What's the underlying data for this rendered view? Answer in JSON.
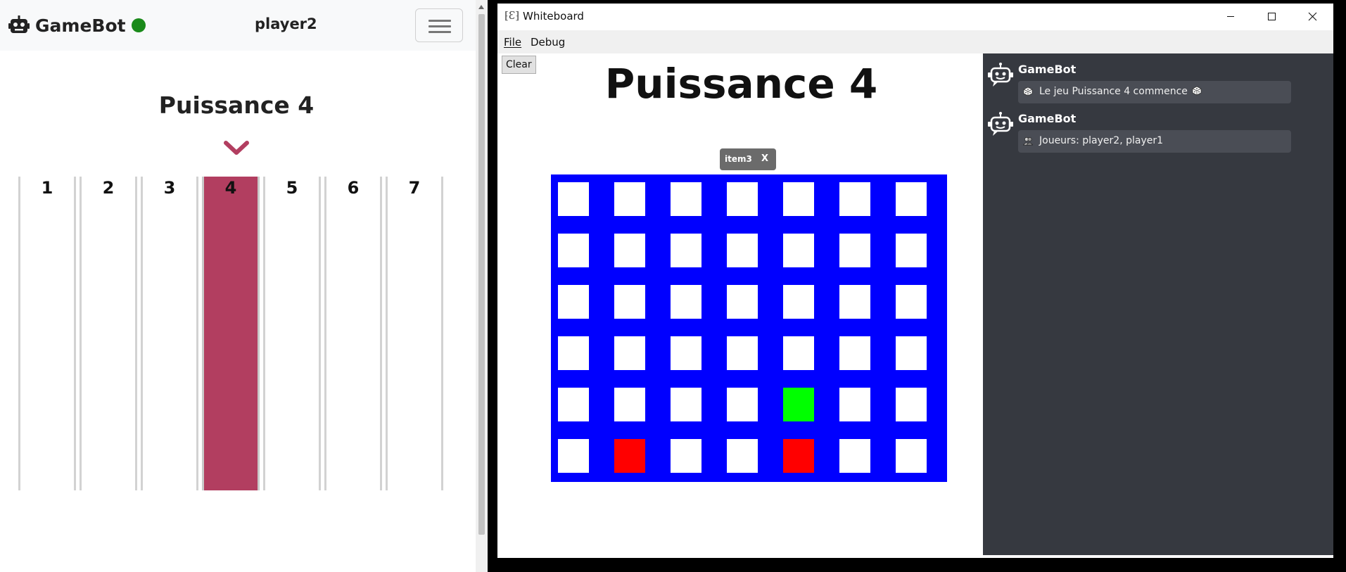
{
  "browser": {
    "brand_label": "GameBot",
    "status_color": "#1a8a1a",
    "player_name": "player2",
    "game_title": "Puissance 4",
    "columns": [
      "1",
      "2",
      "3",
      "4",
      "5",
      "6",
      "7"
    ],
    "selected_column": "4",
    "accent_color": "#b23e60"
  },
  "whiteboard": {
    "window_title": "Whiteboard",
    "menu": {
      "file": "File",
      "debug": "Debug"
    },
    "clear_label": "Clear",
    "heading": "Puissance 4",
    "item_tag": {
      "label": "item3",
      "close": "X"
    },
    "board": {
      "rows": 6,
      "cols": 7,
      "board_color": "#0000ff",
      "empty_color": "#ffffff",
      "pieces": [
        {
          "row": 5,
          "col": 5,
          "color": "#00ff00"
        },
        {
          "row": 6,
          "col": 2,
          "color": "#ff0000"
        },
        {
          "row": 6,
          "col": 5,
          "color": "#ff0000"
        }
      ]
    },
    "chat": [
      {
        "sender": "GameBot",
        "text": "Le jeu Puissance 4 commence",
        "icon": "dice-icon"
      },
      {
        "sender": "GameBot",
        "text": "Joueurs: player2, player1",
        "icon": "players-icon"
      }
    ]
  }
}
